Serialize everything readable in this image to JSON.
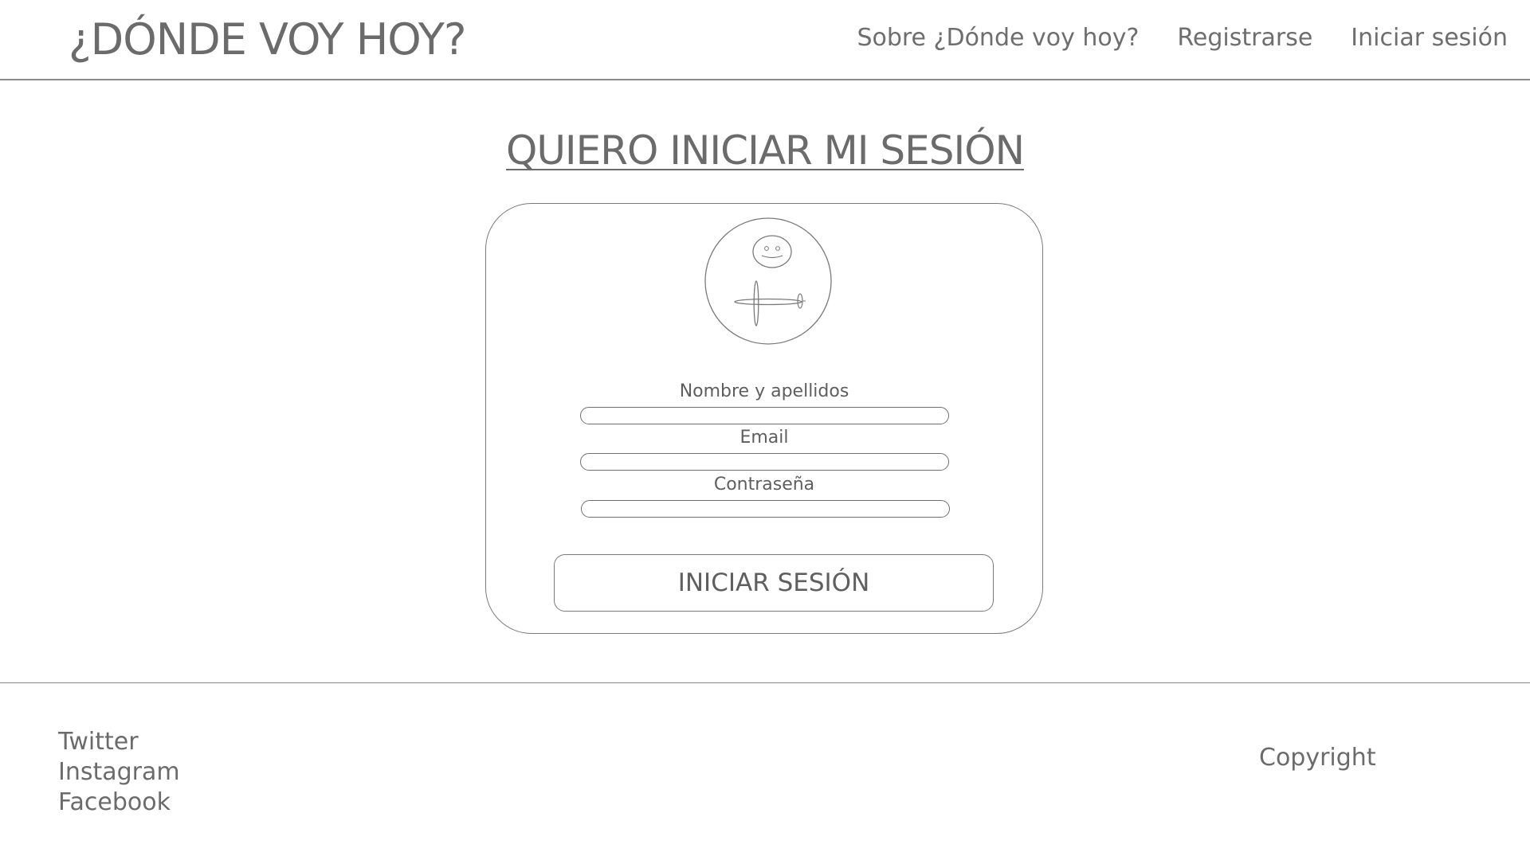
{
  "header": {
    "logo": "¿DÓNDE VOY HOY?",
    "nav": [
      "Sobre ¿Dónde voy hoy?",
      "Registrarse",
      "Iniciar sesión"
    ]
  },
  "main": {
    "title": "QUIERO INICIAR MI SESIÓN",
    "avatar_icon": "user-avatar-icon",
    "fields": {
      "name_label": "Nombre y apellidos",
      "name_value": "",
      "email_label": "Email",
      "email_value": "",
      "password_label": "Contraseña",
      "password_value": ""
    },
    "submit_label": "INICIAR SESIÓN"
  },
  "footer": {
    "social": [
      "Twitter",
      "Instagram",
      "Facebook"
    ],
    "copyright": "Copyright"
  },
  "colors": {
    "text": "#6b6b6b",
    "border": "#7a7a7a",
    "background": "#ffffff"
  }
}
